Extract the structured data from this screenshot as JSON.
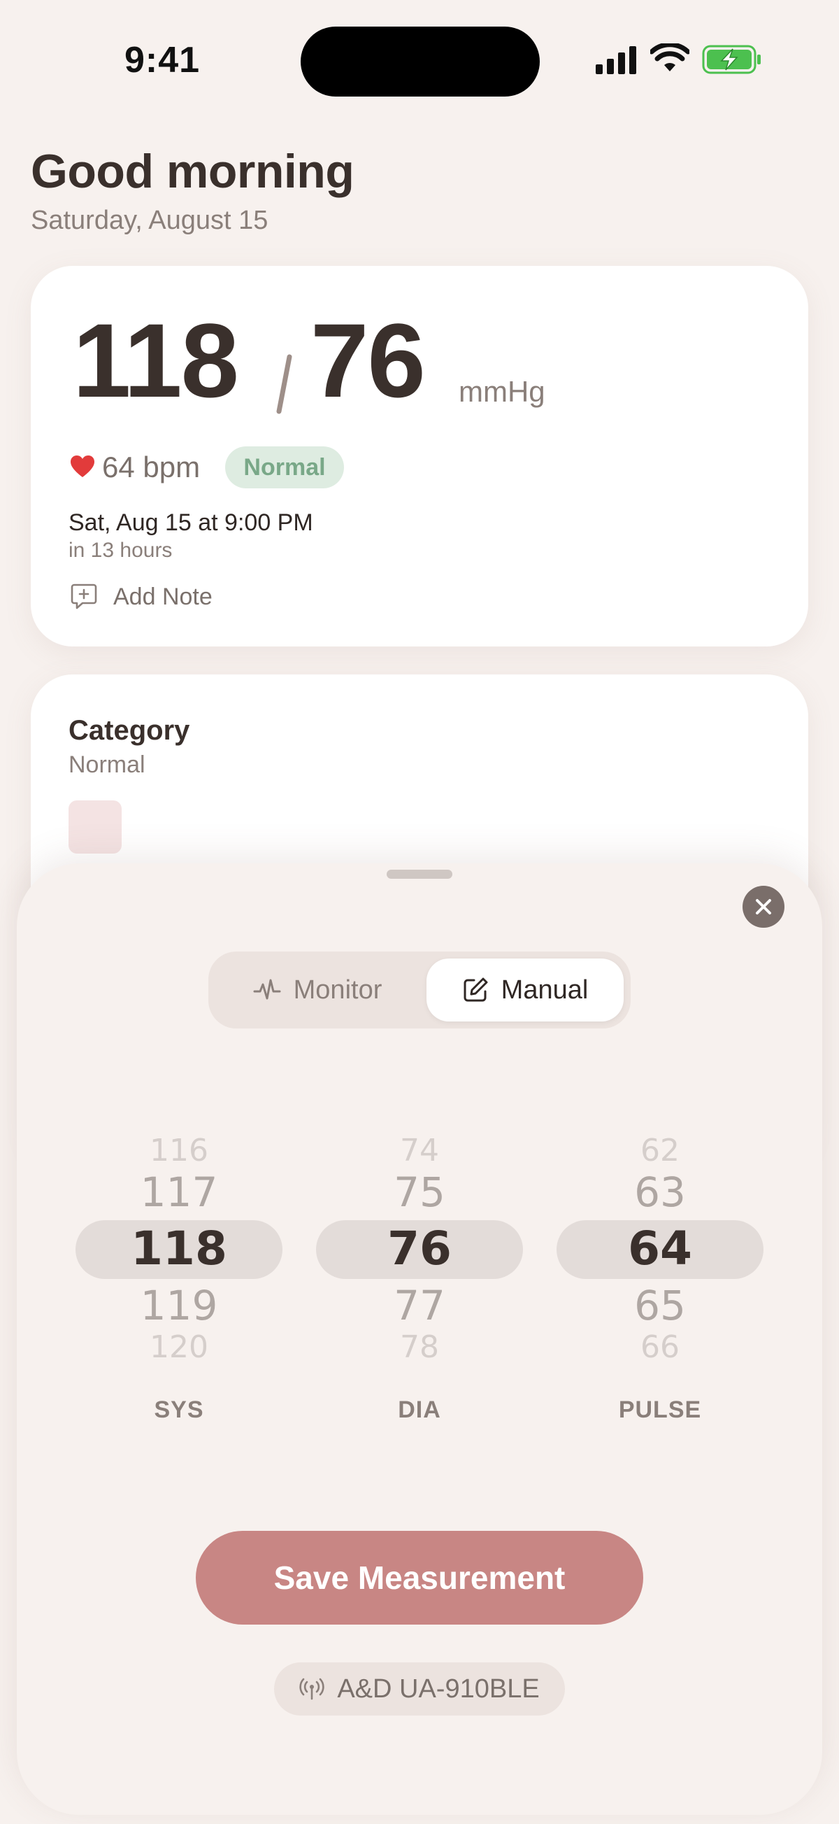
{
  "status_bar": {
    "time": "9:41"
  },
  "header": {
    "greeting": "Good morning",
    "date": "Saturday, August 15"
  },
  "reading": {
    "systolic": "118",
    "diastolic": "76",
    "unit": "mmHg",
    "pulse": "64 bpm",
    "status": "Normal",
    "reminder_time": "Sat, Aug 15 at 9:00 PM",
    "reminder_relative": "in 13 hours",
    "add_note_label": "Add Note"
  },
  "category": {
    "title": "Category",
    "value": "Normal"
  },
  "sheet": {
    "segments": [
      {
        "label": "Monitor",
        "selected": false
      },
      {
        "label": "Manual",
        "selected": true
      }
    ],
    "pickers": {
      "sys": {
        "label": "SYS",
        "values": [
          "116",
          "117",
          "118",
          "119",
          "120"
        ],
        "selected": "118"
      },
      "dia": {
        "label": "DIA",
        "values": [
          "74",
          "75",
          "76",
          "77",
          "78"
        ],
        "selected": "76"
      },
      "pulse": {
        "label": "PULSE",
        "values": [
          "62",
          "63",
          "64",
          "65",
          "66"
        ],
        "selected": "64"
      }
    },
    "save_label": "Save Measurement",
    "device_name": "A&D UA-910BLE"
  },
  "colors": {
    "background": "#f7f1ee",
    "accent": "#c88684",
    "normal_badge_bg": "#deece1",
    "normal_badge_text": "#79a888",
    "heart": "#e23b3b",
    "battery": "#4cc04f"
  }
}
